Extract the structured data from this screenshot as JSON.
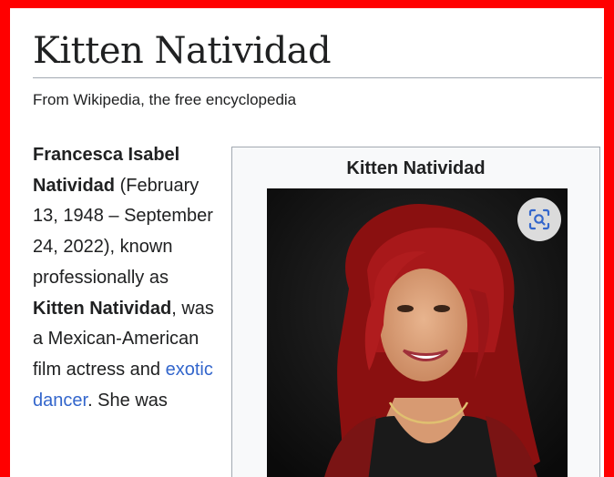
{
  "article": {
    "title": "Kitten Natividad",
    "tagline": "From Wikipedia, the free encyclopedia"
  },
  "lead": {
    "name_bold": "Francesca Isabel Natividad",
    "dates": " (February 13, 1948 – September 24, 2022), known professionally as ",
    "stage_name": "Kitten Natividad",
    "text2": ", was a Mexican-American film actress and ",
    "link_exotic_dancer": "exotic dancer",
    "text3": ". She was"
  },
  "infobox": {
    "title": "Kitten Natividad",
    "lens_icon": "visual-search-icon"
  },
  "colors": {
    "frame_border": "#ff0000",
    "link": "#3366cc",
    "text": "#202122"
  }
}
